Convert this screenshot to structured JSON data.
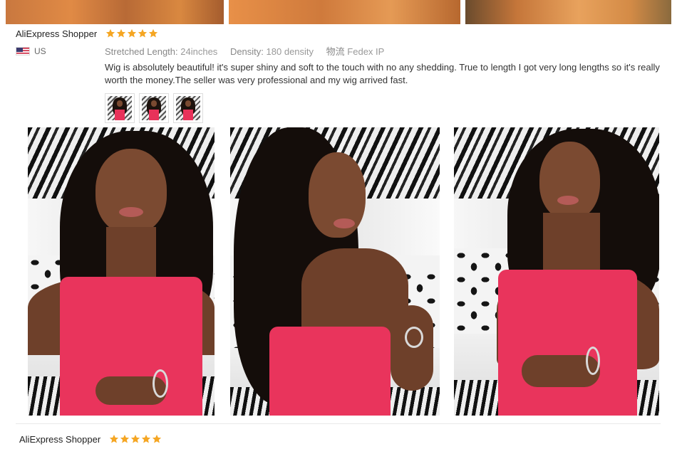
{
  "review1": {
    "reviewer": "AliExpress Shopper",
    "rating": 5,
    "country": "US",
    "flag_icon": "us-flag-icon",
    "props": [
      {
        "key": "Stretched Length:",
        "value": "24inches"
      },
      {
        "key": "Density:",
        "value": "180 density"
      },
      {
        "key": "物流",
        "value": "Fedex IP"
      }
    ],
    "text": "Wig is absolutely beautiful! it's super shiny and soft to the touch with no any shedding. True to length I got very long lengths so it's really worth the money.The seller was very professional and my wig arrived fast.",
    "thumbnail_count": 3,
    "photo_count": 3
  },
  "review2": {
    "reviewer": "AliExpress Shopper",
    "rating": 5
  },
  "colors": {
    "star": "#f5a623",
    "dress": "#e9345c",
    "text": "#333333",
    "meta": "#999999"
  }
}
